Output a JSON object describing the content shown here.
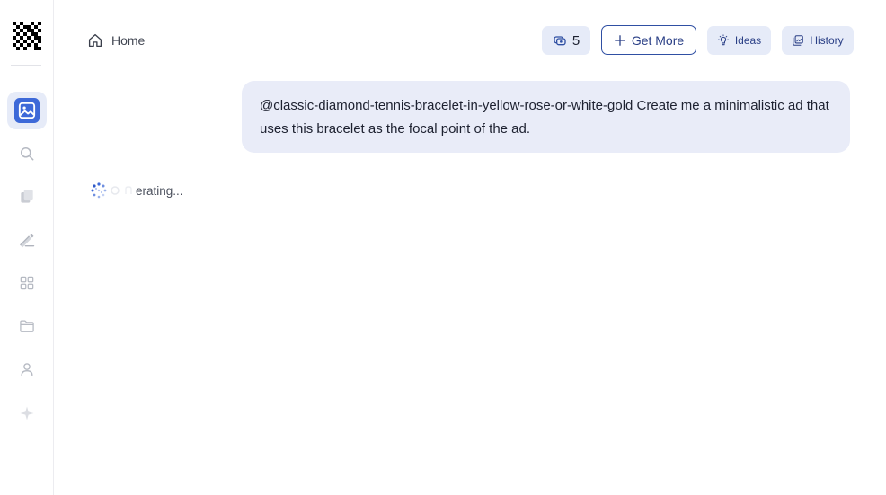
{
  "header": {
    "breadcrumb": {
      "label": "Home",
      "icon": "home-icon"
    },
    "credits": {
      "count": "5",
      "icon": "coins-icon"
    },
    "get_more": {
      "label": "Get More",
      "icon": "plus-icon"
    },
    "ideas": {
      "label": "Ideas",
      "icon": "lightbulb-icon"
    },
    "history": {
      "label": "History",
      "icon": "history-icon"
    }
  },
  "sidebar": {
    "items": [
      {
        "name": "image-icon",
        "active": true
      },
      {
        "name": "search-icon",
        "active": false
      },
      {
        "name": "cards-icon",
        "active": false
      },
      {
        "name": "pen-tool-icon",
        "active": false
      },
      {
        "name": "grid-icon",
        "active": false
      },
      {
        "name": "folder-icon",
        "active": false
      },
      {
        "name": "user-icon",
        "active": false
      },
      {
        "name": "sparkle-icon",
        "active": false
      }
    ]
  },
  "chat": {
    "user_message": "@classic-diamond-tennis-bracelet-in-yellow-rose-or-white-gold Create me a minimalistic ad that uses this bracelet as the focal point of the ad.",
    "status": "erating..."
  },
  "colors": {
    "accent": "#2f4fa3",
    "accent_soft": "#e6ebf8",
    "bubble": "#e9ecf8",
    "icon_muted": "#c3c6ce"
  }
}
